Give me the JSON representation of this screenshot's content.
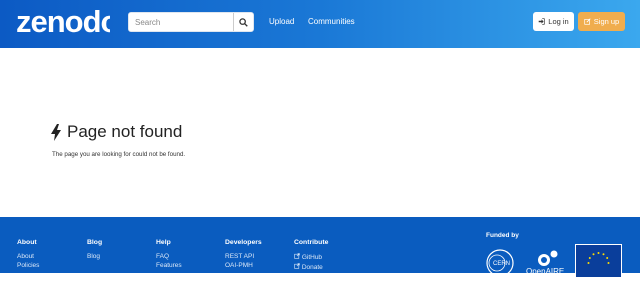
{
  "header": {
    "logo_text": "zenodo",
    "search": {
      "placeholder": "Search",
      "value": ""
    },
    "nav": {
      "upload": "Upload",
      "communities": "Communities"
    },
    "login_label": "Log in",
    "signup_label": "Sign up",
    "signup_color": "#f0ad4e"
  },
  "main": {
    "title": "Page not found",
    "message": "The page you are looking for could not be found."
  },
  "footer": {
    "columns": [
      {
        "heading": "About",
        "links": [
          "About",
          "Policies"
        ]
      },
      {
        "heading": "Blog",
        "links": [
          "Blog"
        ]
      },
      {
        "heading": "Help",
        "links": [
          "FAQ",
          "Features"
        ]
      },
      {
        "heading": "Developers",
        "links": [
          "REST API",
          "OAI-PMH"
        ]
      },
      {
        "heading": "Contribute",
        "links": [
          "GitHub",
          "Donate"
        ]
      }
    ],
    "funded_by": "Funded by",
    "funders": [
      "CERN",
      "OpenAIRE",
      "European Union"
    ]
  },
  "colors": {
    "header_start": "#0c5ac4",
    "header_end": "#3ba8ee",
    "footer": "#0a5cbf"
  }
}
